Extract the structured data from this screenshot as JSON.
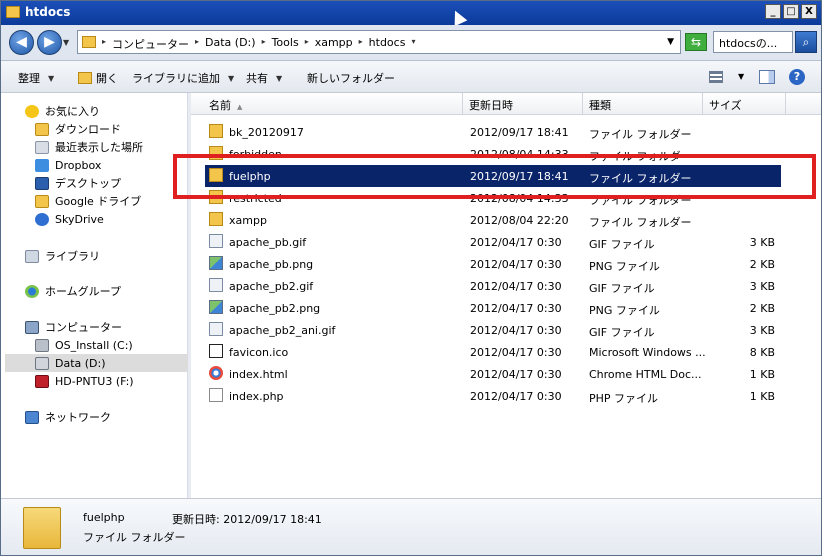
{
  "window": {
    "title": "htdocs",
    "minimize": "_",
    "maximize": "□",
    "close": "X"
  },
  "address": {
    "breadcrumbs": [
      "コンピューター",
      "Data (D:)",
      "Tools",
      "xampp",
      "htdocs"
    ],
    "search_placeholder": "htdocsの..."
  },
  "toolbar": {
    "organize": "整理",
    "open": "開く",
    "add_library": "ライブラリに追加",
    "share": "共有",
    "new_folder": "新しいフォルダー"
  },
  "sidebar": {
    "favorites_header": "お気に入り",
    "favorites": [
      "ダウンロード",
      "最近表示した場所",
      "Dropbox",
      "デスクトップ",
      "Google ドライブ",
      "SkyDrive"
    ],
    "libraries": "ライブラリ",
    "homegroup": "ホームグループ",
    "computer_header": "コンピューター",
    "drives": [
      "OS_Install (C:)",
      "Data (D:)",
      "HD-PNTU3 (F:)"
    ],
    "network": "ネットワーク"
  },
  "columns": {
    "name": "名前",
    "modified": "更新日時",
    "type": "種類",
    "size": "サイズ"
  },
  "files": [
    {
      "name": "bk_20120917",
      "modified": "2012/09/17 18:41",
      "type": "ファイル フォルダー",
      "size": "",
      "icon": "folder"
    },
    {
      "name": "forbidden",
      "modified": "2012/08/04 14:33",
      "type": "ファイル フォルダー",
      "size": "",
      "icon": "folder"
    },
    {
      "name": "fuelphp",
      "modified": "2012/09/17 18:41",
      "type": "ファイル フォルダー",
      "size": "",
      "icon": "folder",
      "selected": true
    },
    {
      "name": "restricted",
      "modified": "2012/08/04 14:33",
      "type": "ファイル フォルダー",
      "size": "",
      "icon": "folder"
    },
    {
      "name": "xampp",
      "modified": "2012/08/04 22:20",
      "type": "ファイル フォルダー",
      "size": "",
      "icon": "folder"
    },
    {
      "name": "apache_pb.gif",
      "modified": "2012/04/17 0:30",
      "type": "GIF ファイル",
      "size": "3 KB",
      "icon": "gif"
    },
    {
      "name": "apache_pb.png",
      "modified": "2012/04/17 0:30",
      "type": "PNG ファイル",
      "size": "2 KB",
      "icon": "png"
    },
    {
      "name": "apache_pb2.gif",
      "modified": "2012/04/17 0:30",
      "type": "GIF ファイル",
      "size": "3 KB",
      "icon": "gif"
    },
    {
      "name": "apache_pb2.png",
      "modified": "2012/04/17 0:30",
      "type": "PNG ファイル",
      "size": "2 KB",
      "icon": "png"
    },
    {
      "name": "apache_pb2_ani.gif",
      "modified": "2012/04/17 0:30",
      "type": "GIF ファイル",
      "size": "3 KB",
      "icon": "gif"
    },
    {
      "name": "favicon.ico",
      "modified": "2012/04/17 0:30",
      "type": "Microsoft Windows ...",
      "size": "8 KB",
      "icon": "ico"
    },
    {
      "name": "index.html",
      "modified": "2012/04/17 0:30",
      "type": "Chrome HTML Doc...",
      "size": "1 KB",
      "icon": "html"
    },
    {
      "name": "index.php",
      "modified": "2012/04/17 0:30",
      "type": "PHP ファイル",
      "size": "1 KB",
      "icon": "php"
    }
  ],
  "details": {
    "name": "fuelphp",
    "modified": "更新日時: 2012/09/17 18:41",
    "type": "ファイル フォルダー"
  },
  "colors": {
    "selection": "#0a246a",
    "highlight_box": "#e02020"
  }
}
